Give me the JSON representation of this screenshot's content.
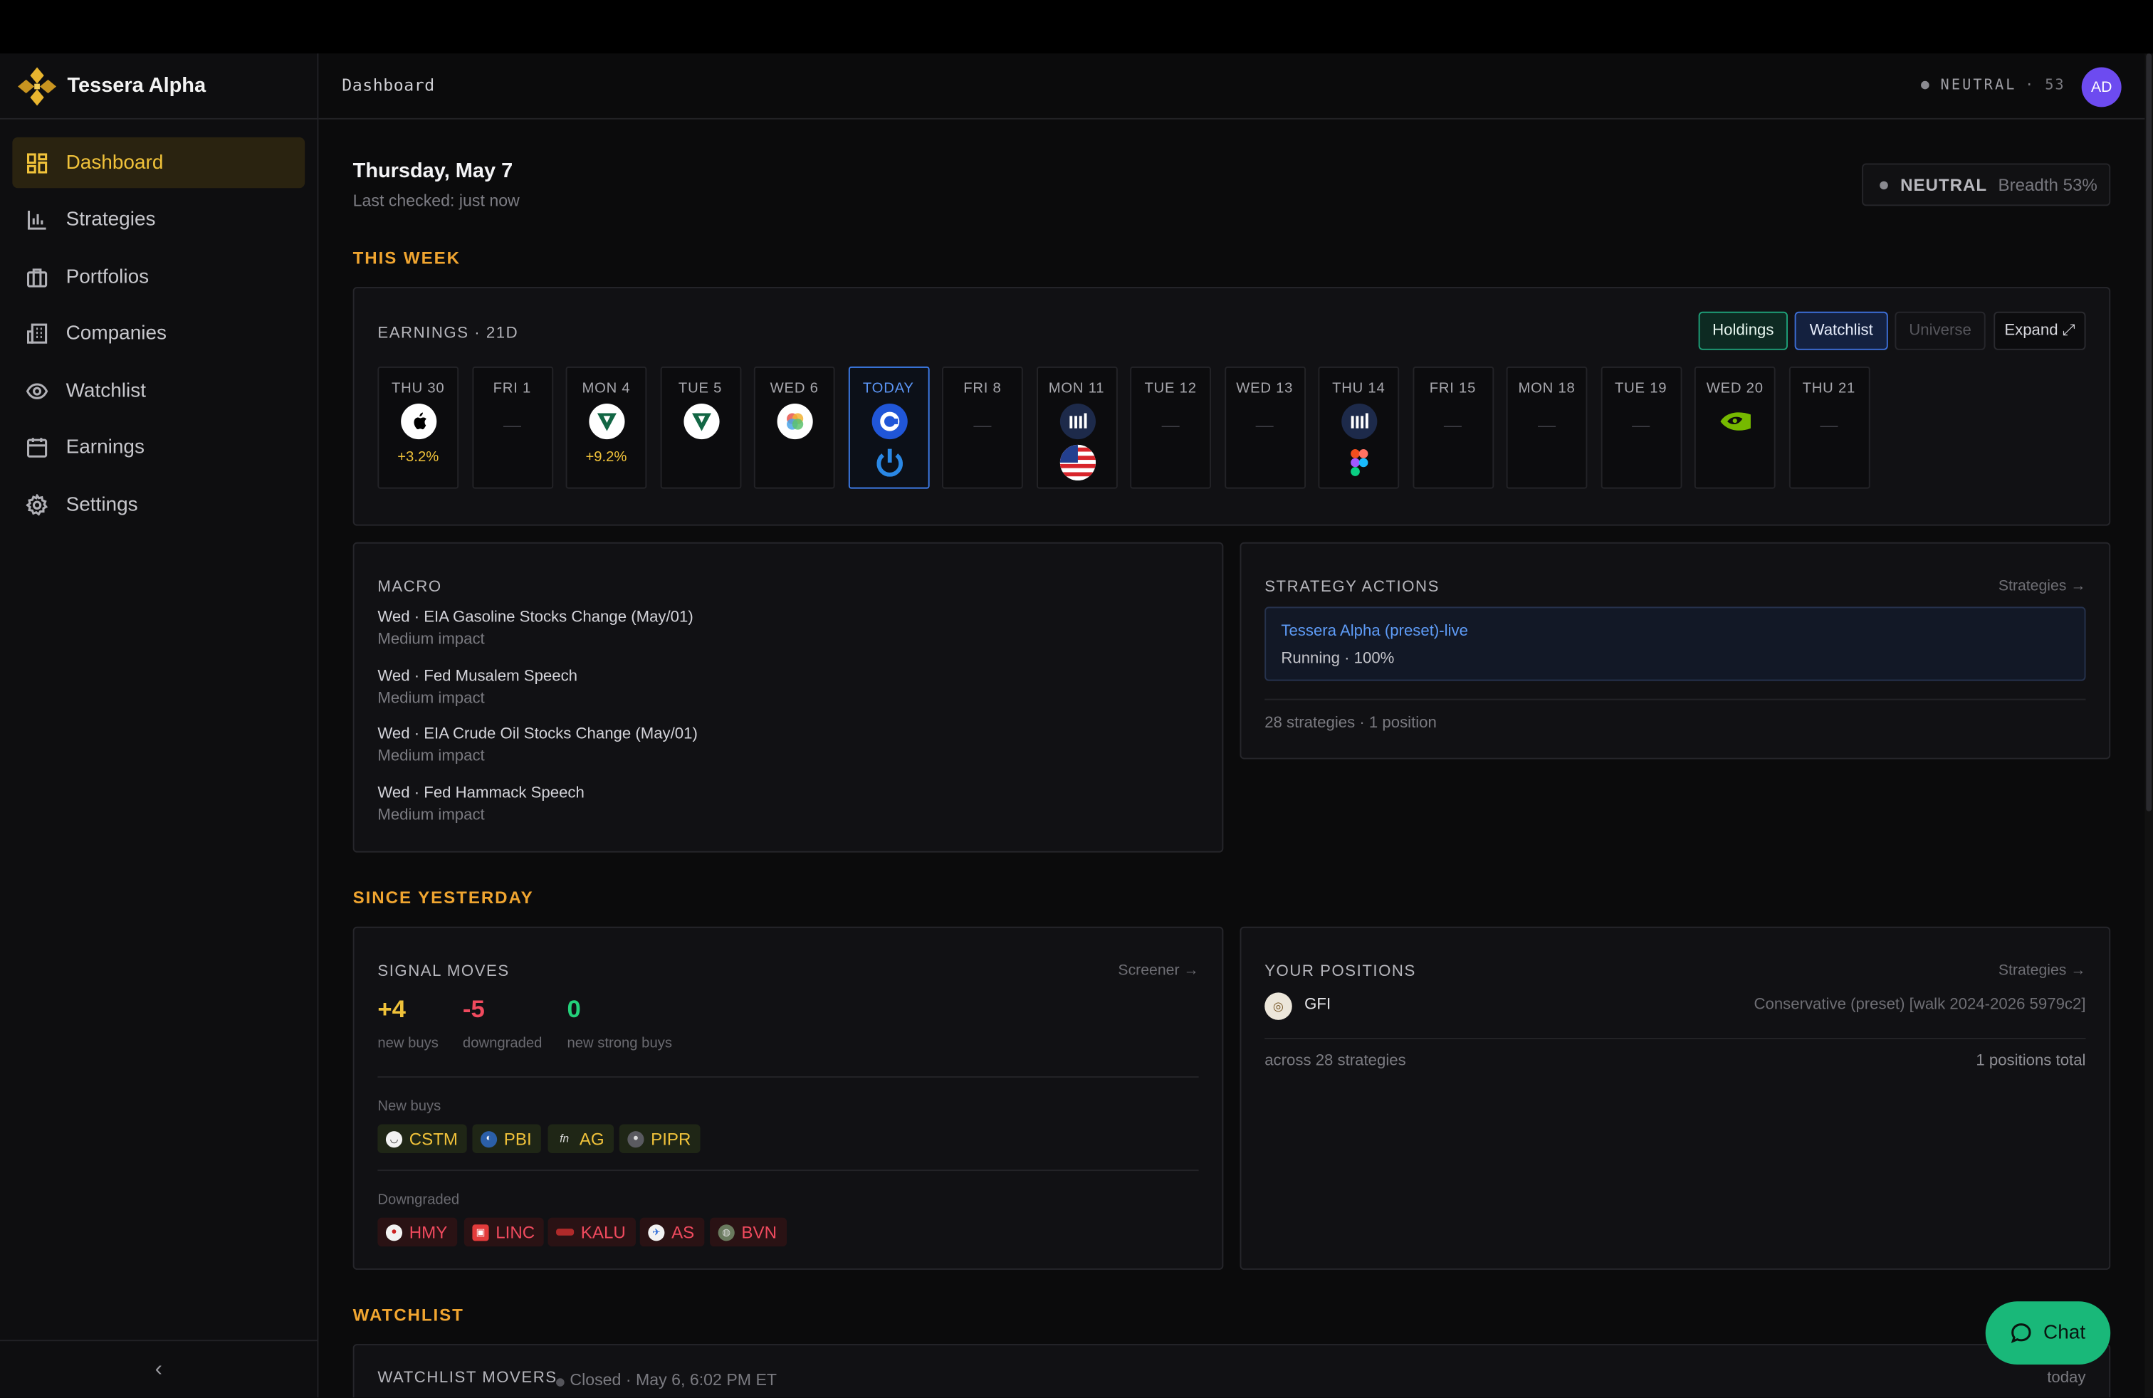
{
  "app": {
    "name": "Tessera Alpha"
  },
  "nav": {
    "items": [
      {
        "label": "Dashboard",
        "icon": "grid-icon",
        "active": true
      },
      {
        "label": "Strategies",
        "icon": "bar-chart-icon"
      },
      {
        "label": "Portfolios",
        "icon": "briefcase-icon"
      },
      {
        "label": "Companies",
        "icon": "building-icon"
      },
      {
        "label": "Watchlist",
        "icon": "eye-icon"
      },
      {
        "label": "Earnings",
        "icon": "calendar-icon"
      },
      {
        "label": "Settings",
        "icon": "gear-icon"
      }
    ],
    "collapse_glyph": "‹"
  },
  "header": {
    "breadcrumb": "Dashboard",
    "regime_label": "NEUTRAL",
    "regime_value": "· 53",
    "avatar": "AD"
  },
  "main": {
    "date": "Thursday, May 7",
    "last_checked": "Last checked: just now",
    "breadth": {
      "label": "NEUTRAL",
      "value": "Breadth 53%"
    }
  },
  "this_week": {
    "section": "THIS WEEK",
    "earnings": {
      "title": "EARNINGS · 21D",
      "filters": {
        "holdings": "Holdings",
        "watchlist": "Watchlist",
        "universe": "Universe",
        "expand": "Expand ⤢"
      },
      "days": [
        {
          "label": "THU 30",
          "change": "+3.2%"
        },
        {
          "label": "FRI 1",
          "dash": "—"
        },
        {
          "label": "MON 4",
          "change": "+9.2%"
        },
        {
          "label": "TUE 5"
        },
        {
          "label": "WED 6"
        },
        {
          "label": "TODAY"
        },
        {
          "label": "FRI 8",
          "dash": "—"
        },
        {
          "label": "MON 11"
        },
        {
          "label": "TUE 12",
          "dash": "—"
        },
        {
          "label": "WED 13",
          "dash": "—"
        },
        {
          "label": "THU 14"
        },
        {
          "label": "FRI 15",
          "dash": "—"
        },
        {
          "label": "MON 18",
          "dash": "—"
        },
        {
          "label": "TUE 19",
          "dash": "—"
        },
        {
          "label": "WED 20"
        },
        {
          "label": "THU 21",
          "dash": "—"
        }
      ]
    },
    "macro": {
      "title": "MACRO",
      "items": [
        {
          "title": "Wed · EIA Gasoline Stocks Change (May/01)",
          "impact": "Medium impact"
        },
        {
          "title": "Wed · Fed Musalem Speech",
          "impact": "Medium impact"
        },
        {
          "title": "Wed · EIA Crude Oil Stocks Change (May/01)",
          "impact": "Medium impact"
        },
        {
          "title": "Wed · Fed Hammack Speech",
          "impact": "Medium impact"
        }
      ]
    },
    "strategy_actions": {
      "title": "STRATEGY ACTIONS",
      "link": "Strategies →",
      "strategy_name": "Tessera Alpha (preset)-live",
      "strategy_status": "Running · 100%",
      "summary": "28 strategies · 1 position"
    }
  },
  "since_yesterday": {
    "section": "SINCE YESTERDAY",
    "signal_moves": {
      "title": "SIGNAL MOVES",
      "link": "Screener →",
      "stats": [
        {
          "value": "+4",
          "label": "new buys",
          "color": "#f0c23a"
        },
        {
          "value": "-5",
          "label": "downgraded",
          "color": "#f04a5e"
        },
        {
          "value": "0",
          "label": "new strong buys",
          "color": "#23d17a"
        }
      ],
      "new_buys_label": "New buys",
      "new_buys": [
        "CSTM",
        "PBI",
        "AG",
        "PIPR"
      ],
      "downgraded_label": "Downgraded",
      "downgraded": [
        "HMY",
        "LINC",
        "KALU",
        "AS",
        "BVN"
      ]
    },
    "positions": {
      "title": "YOUR POSITIONS",
      "link": "Strategies →",
      "ticker": "GFI",
      "strategy": "Conservative (preset) [walk 2024-2026 5979c2]",
      "footer_left": "across 28 strategies",
      "footer_right": "1 positions total"
    }
  },
  "watchlist": {
    "section": "WATCHLIST",
    "movers_title": "WATCHLIST MOVERS",
    "movers_status": "Closed · May 6, 6:02 PM ET",
    "movers_right": "today"
  },
  "chat": {
    "label": "Chat"
  },
  "colors": {
    "accent": "#f0c23a",
    "section": "#f0a530",
    "buy": "#f0c23a",
    "down": "#f04a5e",
    "strong": "#23d17a",
    "chat": "#19b879",
    "today": "#3d7be8"
  }
}
